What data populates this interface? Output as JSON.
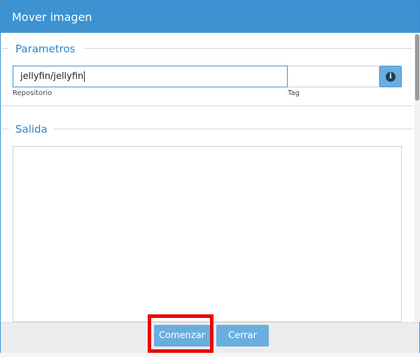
{
  "dialog": {
    "title": "Mover imagen"
  },
  "parametros": {
    "legend": "Parametros",
    "repository": {
      "value": "jellyfin/jellyfin",
      "label": "Repositorio"
    },
    "tag": {
      "value": "",
      "label": "Tag"
    },
    "info_icon": "info-icon"
  },
  "salida": {
    "legend": "Salida",
    "output_text": ""
  },
  "footer": {
    "start_label": "Comenzar",
    "close_label": "Cerrar"
  },
  "colors": {
    "titlebar": "#3d93d1",
    "button": "#6aaee0",
    "legend": "#2f86c4",
    "highlight": "#ee0000"
  }
}
